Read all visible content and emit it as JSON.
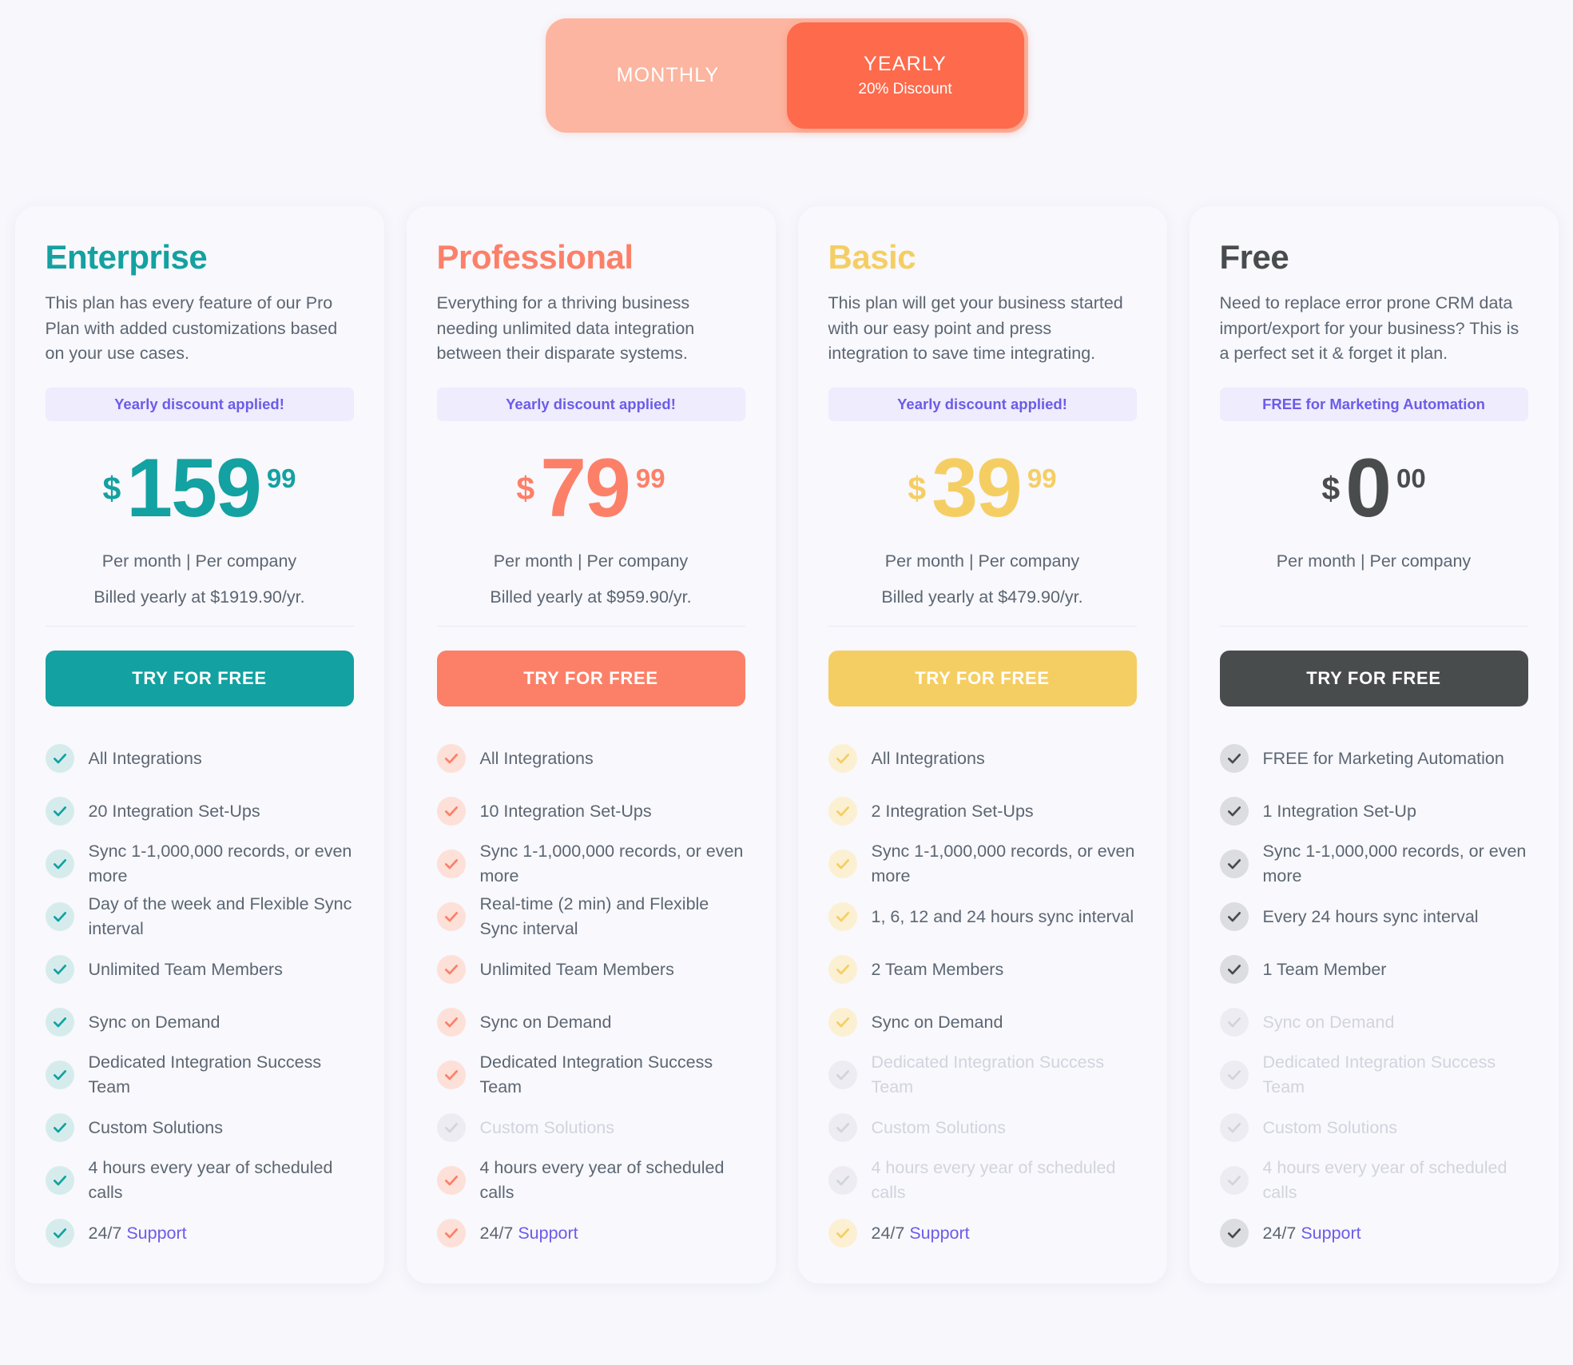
{
  "billing_toggle": {
    "monthly": {
      "label": "MONTHLY",
      "active": false
    },
    "yearly": {
      "label": "YEARLY",
      "sub_label": "20% Discount",
      "active": true
    }
  },
  "theme": {
    "page_bg": "#f7f7fc",
    "card_bg": "#f8f8fd",
    "badge_bg": "#eeecfd",
    "badge_text": "#6c5ce7",
    "body_text": "#5c6672",
    "disabled_text": "#d2d4dd",
    "toggle_track": "#fcb5a0",
    "toggle_active": "#fd6a4c"
  },
  "plans": [
    {
      "name": "Enterprise",
      "accent": "#13a1a1",
      "check_bg": "#d6ecec",
      "description": "This plan has every feature of our Pro Plan with added customizations based on your use cases.",
      "badge": "Yearly discount applied!",
      "currency": "$",
      "amount": "159",
      "cents": "99",
      "per_line": "Per month | Per company",
      "billed_line": "Billed yearly at $1919.90/yr.",
      "cta_label": "TRY FOR FREE",
      "features": [
        {
          "text": "All Integrations",
          "enabled": true
        },
        {
          "text": "20 Integration Set-Ups",
          "enabled": true
        },
        {
          "text": "Sync 1-1,000,000 records, or even more",
          "enabled": true
        },
        {
          "text": "Day of the week and Flexible Sync interval",
          "enabled": true
        },
        {
          "text": "Unlimited Team Members",
          "enabled": true
        },
        {
          "text": "Sync on Demand",
          "enabled": true
        },
        {
          "text": "Dedicated Integration Success Team",
          "enabled": true
        },
        {
          "text": "Custom Solutions",
          "enabled": true
        },
        {
          "text": "4 hours every year of scheduled calls",
          "enabled": true
        },
        {
          "text": "24/7 ",
          "link_text": "Support",
          "enabled": true
        }
      ]
    },
    {
      "name": "Professional",
      "accent": "#fc8068",
      "check_bg": "#fde0d8",
      "description": "Everything for a thriving business needing unlimited data integration between their disparate systems.",
      "badge": "Yearly discount applied!",
      "currency": "$",
      "amount": "79",
      "cents": "99",
      "per_line": "Per month | Per company",
      "billed_line": "Billed yearly at $959.90/yr.",
      "cta_label": "TRY FOR FREE",
      "features": [
        {
          "text": "All Integrations",
          "enabled": true
        },
        {
          "text": "10 Integration Set-Ups",
          "enabled": true
        },
        {
          "text": "Sync 1-1,000,000 records, or even more",
          "enabled": true
        },
        {
          "text": "Real-time (2 min) and Flexible Sync interval",
          "enabled": true
        },
        {
          "text": "Unlimited Team Members",
          "enabled": true
        },
        {
          "text": "Sync on Demand",
          "enabled": true
        },
        {
          "text": "Dedicated Integration Success Team",
          "enabled": true
        },
        {
          "text": "Custom Solutions",
          "enabled": false
        },
        {
          "text": "4 hours every year of scheduled calls",
          "enabled": true
        },
        {
          "text": "24/7 ",
          "link_text": "Support",
          "enabled": true
        }
      ]
    },
    {
      "name": "Basic",
      "accent": "#f5ce63",
      "check_bg": "#fcf0d2",
      "description": "This plan will get your business started with our easy point and press integration to save time integrating.",
      "badge": "Yearly discount applied!",
      "currency": "$",
      "amount": "39",
      "cents": "99",
      "per_line": "Per month | Per company",
      "billed_line": "Billed yearly at $479.90/yr.",
      "cta_label": "TRY FOR FREE",
      "features": [
        {
          "text": "All Integrations",
          "enabled": true
        },
        {
          "text": "2 Integration Set-Ups",
          "enabled": true
        },
        {
          "text": "Sync 1-1,000,000 records, or even more",
          "enabled": true
        },
        {
          "text": "1, 6, 12 and 24 hours sync interval",
          "enabled": true
        },
        {
          "text": "2 Team Members",
          "enabled": true
        },
        {
          "text": "Sync on Demand",
          "enabled": true
        },
        {
          "text": "Dedicated Integration Success Team",
          "enabled": false
        },
        {
          "text": "Custom Solutions",
          "enabled": false
        },
        {
          "text": "4 hours every year of scheduled calls",
          "enabled": false
        },
        {
          "text": "24/7 ",
          "link_text": "Support",
          "enabled": true
        }
      ]
    },
    {
      "name": "Free",
      "accent": "#494c4d",
      "check_bg": "#dcdde1",
      "description": "Need to replace error prone CRM data import/export for your business? This is a perfect set it & forget it plan.",
      "badge": "FREE for Marketing Automation",
      "currency": "$",
      "amount": "0",
      "cents": "00",
      "per_line": "Per month | Per company",
      "billed_line": "",
      "cta_label": "TRY FOR FREE",
      "features": [
        {
          "text": "FREE for Marketing Automation",
          "enabled": true
        },
        {
          "text": "1 Integration Set-Up",
          "enabled": true
        },
        {
          "text": "Sync 1-1,000,000 records, or even more",
          "enabled": true
        },
        {
          "text": "Every 24 hours sync interval",
          "enabled": true
        },
        {
          "text": "1 Team Member",
          "enabled": true
        },
        {
          "text": "Sync on Demand",
          "enabled": false
        },
        {
          "text": "Dedicated Integration Success Team",
          "enabled": false
        },
        {
          "text": "Custom Solutions",
          "enabled": false
        },
        {
          "text": "4 hours every year of scheduled calls",
          "enabled": false
        },
        {
          "text": "24/7 ",
          "link_text": "Support",
          "enabled": true
        }
      ]
    }
  ]
}
